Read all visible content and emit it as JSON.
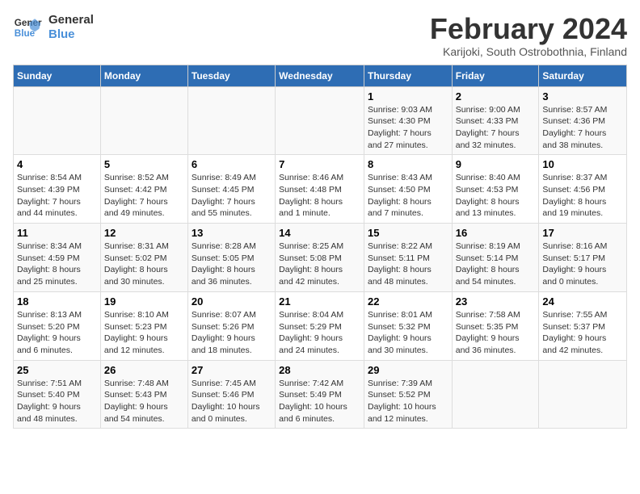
{
  "logo": {
    "text_general": "General",
    "text_blue": "Blue"
  },
  "title": "February 2024",
  "subtitle": "Karijoki, South Ostrobothnia, Finland",
  "days_of_week": [
    "Sunday",
    "Monday",
    "Tuesday",
    "Wednesday",
    "Thursday",
    "Friday",
    "Saturday"
  ],
  "weeks": [
    [
      {
        "day": "",
        "info": ""
      },
      {
        "day": "",
        "info": ""
      },
      {
        "day": "",
        "info": ""
      },
      {
        "day": "",
        "info": ""
      },
      {
        "day": "1",
        "info": "Sunrise: 9:03 AM\nSunset: 4:30 PM\nDaylight: 7 hours\nand 27 minutes."
      },
      {
        "day": "2",
        "info": "Sunrise: 9:00 AM\nSunset: 4:33 PM\nDaylight: 7 hours\nand 32 minutes."
      },
      {
        "day": "3",
        "info": "Sunrise: 8:57 AM\nSunset: 4:36 PM\nDaylight: 7 hours\nand 38 minutes."
      }
    ],
    [
      {
        "day": "4",
        "info": "Sunrise: 8:54 AM\nSunset: 4:39 PM\nDaylight: 7 hours\nand 44 minutes."
      },
      {
        "day": "5",
        "info": "Sunrise: 8:52 AM\nSunset: 4:42 PM\nDaylight: 7 hours\nand 49 minutes."
      },
      {
        "day": "6",
        "info": "Sunrise: 8:49 AM\nSunset: 4:45 PM\nDaylight: 7 hours\nand 55 minutes."
      },
      {
        "day": "7",
        "info": "Sunrise: 8:46 AM\nSunset: 4:48 PM\nDaylight: 8 hours\nand 1 minute."
      },
      {
        "day": "8",
        "info": "Sunrise: 8:43 AM\nSunset: 4:50 PM\nDaylight: 8 hours\nand 7 minutes."
      },
      {
        "day": "9",
        "info": "Sunrise: 8:40 AM\nSunset: 4:53 PM\nDaylight: 8 hours\nand 13 minutes."
      },
      {
        "day": "10",
        "info": "Sunrise: 8:37 AM\nSunset: 4:56 PM\nDaylight: 8 hours\nand 19 minutes."
      }
    ],
    [
      {
        "day": "11",
        "info": "Sunrise: 8:34 AM\nSunset: 4:59 PM\nDaylight: 8 hours\nand 25 minutes."
      },
      {
        "day": "12",
        "info": "Sunrise: 8:31 AM\nSunset: 5:02 PM\nDaylight: 8 hours\nand 30 minutes."
      },
      {
        "day": "13",
        "info": "Sunrise: 8:28 AM\nSunset: 5:05 PM\nDaylight: 8 hours\nand 36 minutes."
      },
      {
        "day": "14",
        "info": "Sunrise: 8:25 AM\nSunset: 5:08 PM\nDaylight: 8 hours\nand 42 minutes."
      },
      {
        "day": "15",
        "info": "Sunrise: 8:22 AM\nSunset: 5:11 PM\nDaylight: 8 hours\nand 48 minutes."
      },
      {
        "day": "16",
        "info": "Sunrise: 8:19 AM\nSunset: 5:14 PM\nDaylight: 8 hours\nand 54 minutes."
      },
      {
        "day": "17",
        "info": "Sunrise: 8:16 AM\nSunset: 5:17 PM\nDaylight: 9 hours\nand 0 minutes."
      }
    ],
    [
      {
        "day": "18",
        "info": "Sunrise: 8:13 AM\nSunset: 5:20 PM\nDaylight: 9 hours\nand 6 minutes."
      },
      {
        "day": "19",
        "info": "Sunrise: 8:10 AM\nSunset: 5:23 PM\nDaylight: 9 hours\nand 12 minutes."
      },
      {
        "day": "20",
        "info": "Sunrise: 8:07 AM\nSunset: 5:26 PM\nDaylight: 9 hours\nand 18 minutes."
      },
      {
        "day": "21",
        "info": "Sunrise: 8:04 AM\nSunset: 5:29 PM\nDaylight: 9 hours\nand 24 minutes."
      },
      {
        "day": "22",
        "info": "Sunrise: 8:01 AM\nSunset: 5:32 PM\nDaylight: 9 hours\nand 30 minutes."
      },
      {
        "day": "23",
        "info": "Sunrise: 7:58 AM\nSunset: 5:35 PM\nDaylight: 9 hours\nand 36 minutes."
      },
      {
        "day": "24",
        "info": "Sunrise: 7:55 AM\nSunset: 5:37 PM\nDaylight: 9 hours\nand 42 minutes."
      }
    ],
    [
      {
        "day": "25",
        "info": "Sunrise: 7:51 AM\nSunset: 5:40 PM\nDaylight: 9 hours\nand 48 minutes."
      },
      {
        "day": "26",
        "info": "Sunrise: 7:48 AM\nSunset: 5:43 PM\nDaylight: 9 hours\nand 54 minutes."
      },
      {
        "day": "27",
        "info": "Sunrise: 7:45 AM\nSunset: 5:46 PM\nDaylight: 10 hours\nand 0 minutes."
      },
      {
        "day": "28",
        "info": "Sunrise: 7:42 AM\nSunset: 5:49 PM\nDaylight: 10 hours\nand 6 minutes."
      },
      {
        "day": "29",
        "info": "Sunrise: 7:39 AM\nSunset: 5:52 PM\nDaylight: 10 hours\nand 12 minutes."
      },
      {
        "day": "",
        "info": ""
      },
      {
        "day": "",
        "info": ""
      }
    ]
  ]
}
